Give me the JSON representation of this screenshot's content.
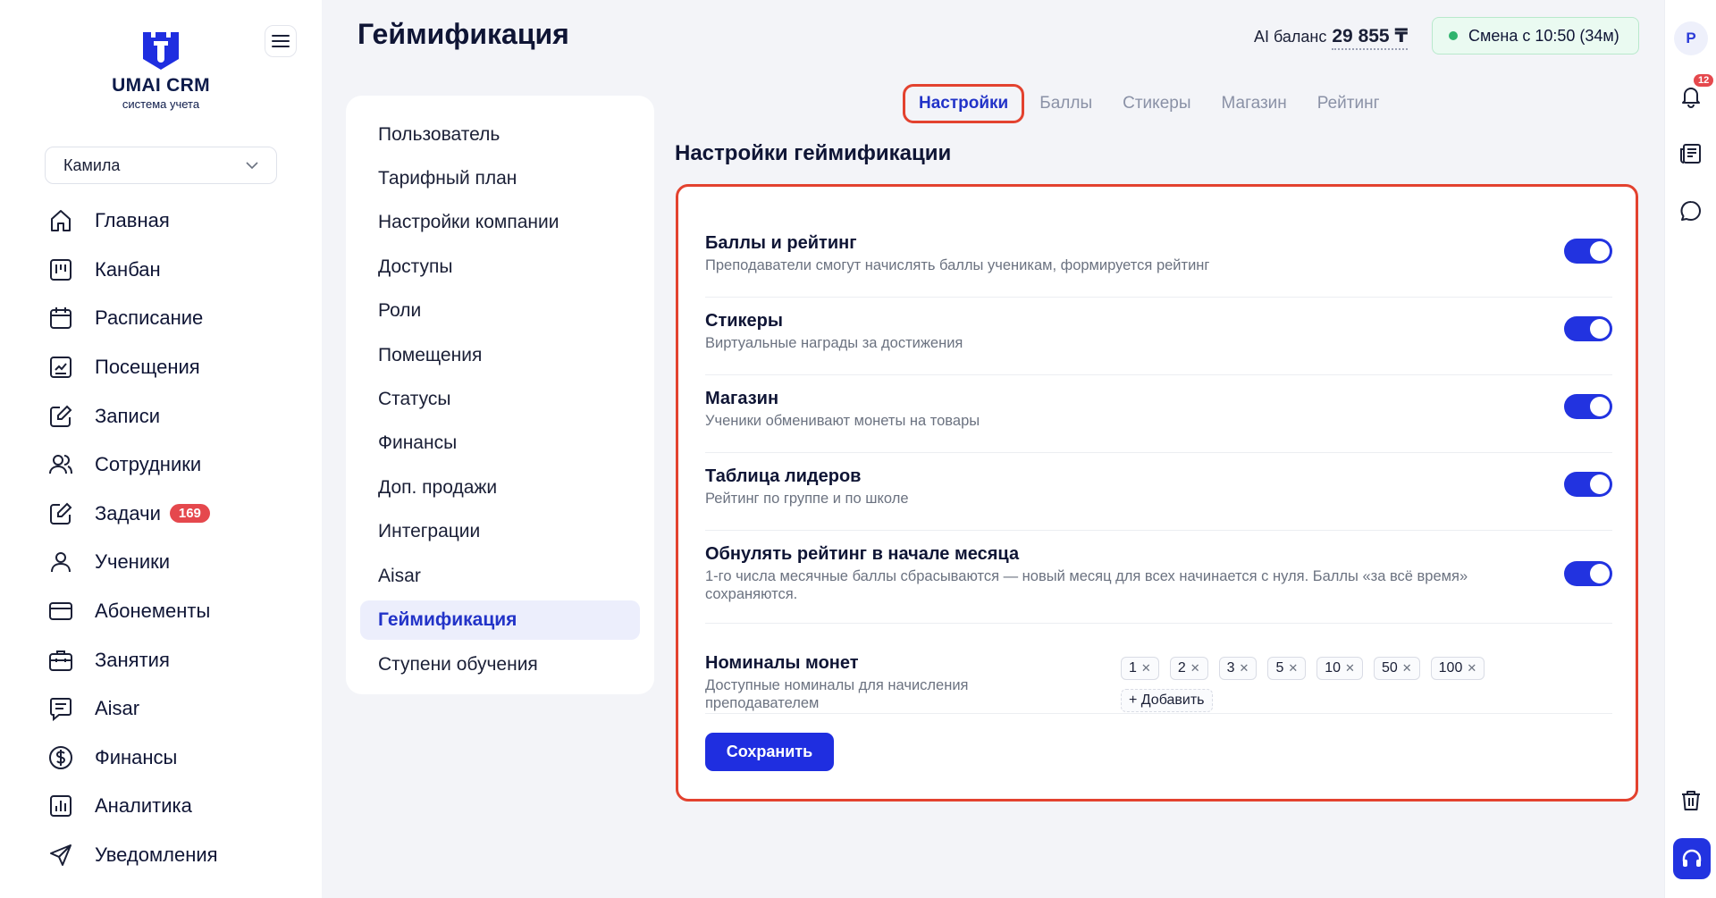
{
  "brand": {
    "title": "UMAI CRM",
    "subtitle": "система учета"
  },
  "user_select": {
    "value": "Камила"
  },
  "nav": [
    {
      "label": "Главная",
      "icon": "home-icon"
    },
    {
      "label": "Канбан",
      "icon": "kanban-icon"
    },
    {
      "label": "Расписание",
      "icon": "calendar-icon"
    },
    {
      "label": "Посещения",
      "icon": "chart-check-icon"
    },
    {
      "label": "Записи",
      "icon": "edit-icon"
    },
    {
      "label": "Сотрудники",
      "icon": "users-icon"
    },
    {
      "label": "Задачи",
      "icon": "edit-icon",
      "badge": "169"
    },
    {
      "label": "Ученики",
      "icon": "user-icon"
    },
    {
      "label": "Абонементы",
      "icon": "card-icon"
    },
    {
      "label": "Занятия",
      "icon": "briefcase-icon"
    },
    {
      "label": "Aisar",
      "icon": "message-icon"
    },
    {
      "label": "Финансы",
      "icon": "dollar-icon"
    },
    {
      "label": "Аналитика",
      "icon": "bar-chart-icon"
    },
    {
      "label": "Уведомления",
      "icon": "send-icon"
    }
  ],
  "header": {
    "title": "Геймификация",
    "ai_balance_label": "AI баланс",
    "ai_balance_value": "29 855 ₸",
    "shift": "Смена с 10:50 (34м)"
  },
  "rail": {
    "avatar": "Р",
    "notifications_count": "12"
  },
  "settings_menu": [
    "Пользователь",
    "Тарифный план",
    "Настройки компании",
    "Доступы",
    "Роли",
    "Помещения",
    "Статусы",
    "Финансы",
    "Доп. продажи",
    "Интеграции",
    "Aisar",
    "Геймификация",
    "Ступени обучения"
  ],
  "settings_menu_active": "Геймификация",
  "tabs": [
    "Настройки",
    "Баллы",
    "Стикеры",
    "Магазин",
    "Рейтинг"
  ],
  "active_tab": "Настройки",
  "section_title": "Настройки геймификации",
  "options": [
    {
      "title": "Баллы и рейтинг",
      "desc": "Преподаватели смогут начислять баллы ученикам, формируется рейтинг",
      "enabled": true
    },
    {
      "title": "Стикеры",
      "desc": "Виртуальные награды за достижения",
      "enabled": true
    },
    {
      "title": "Магазин",
      "desc": "Ученики обменивают монеты на товары",
      "enabled": true
    },
    {
      "title": "Таблица лидеров",
      "desc": "Рейтинг по группе и по школе",
      "enabled": true
    },
    {
      "title": "Обнулять рейтинг в начале месяца",
      "desc": "1-го числа месячные баллы сбрасываются — новый месяц для всех начинается с нуля. Баллы «за всё время» сохраняются.",
      "enabled": true
    }
  ],
  "coins": {
    "title": "Номиналы монет",
    "desc": "Доступные номиналы для начисления преподавателем",
    "values": [
      "1",
      "2",
      "3",
      "5",
      "10",
      "50",
      "100"
    ],
    "add_label": "+ Добавить"
  },
  "save_label": "Сохранить",
  "colors": {
    "accent": "#1f2ee0",
    "highlight": "#e3422f",
    "badge": "#e5484d",
    "success": "#2fb36d"
  }
}
